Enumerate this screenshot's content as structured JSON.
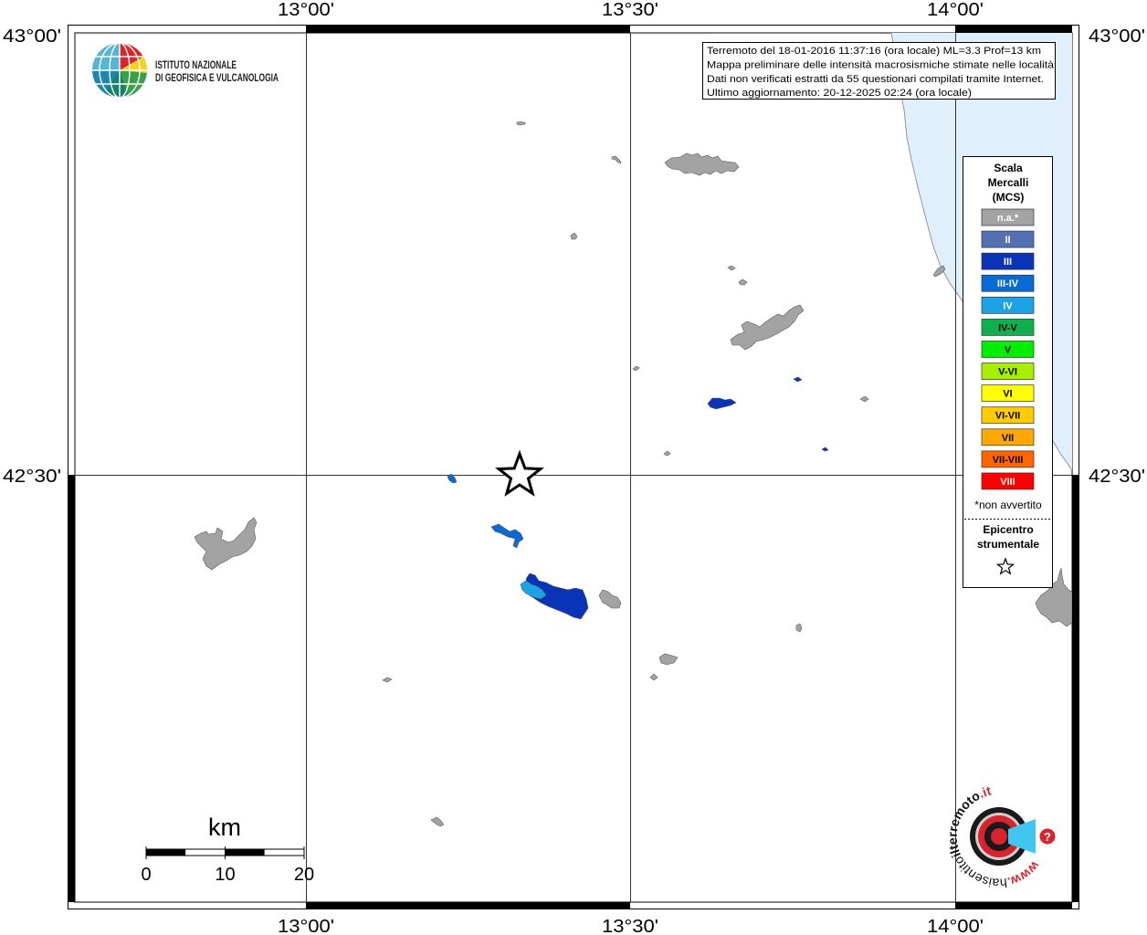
{
  "header": {
    "lon_labels": [
      "13°00'",
      "13°30'",
      "14°00'"
    ],
    "lat_labels": [
      "43°00'",
      "42°30'"
    ]
  },
  "logo_ingv": {
    "line1": "ISTITUTO NAZIONALE",
    "line2": "DI GEOFISICA E VULCANOLOGIA",
    "icon": "globe-icon"
  },
  "info": {
    "lines": [
      "Terremoto del 18-01-2016 11:37:16 (ora locale) ML=3.3 Prof=13 km",
      "Mappa preliminare delle intensità macrosismiche stimate nelle località",
      "Dati non verificati estratti da 55 questionari compilati tramite Internet.",
      "Ultimo aggiornamento: 20-12-2025 02:24 (ora locale)"
    ]
  },
  "legend": {
    "title_lines": [
      "Scala",
      "Mercalli",
      "(MCS)"
    ],
    "classes": [
      {
        "label": "n.a.*",
        "color": "#a3a3a3",
        "text_color": "#ffffff"
      },
      {
        "label": "II",
        "color": "#5470b4",
        "text_color": "#ffffff"
      },
      {
        "label": "III",
        "color": "#0a34b8",
        "text_color": "#ffffff"
      },
      {
        "label": "III-IV",
        "color": "#0a6ad4",
        "text_color": "#ffffff"
      },
      {
        "label": "IV",
        "color": "#1ca3e6",
        "text_color": "#ffffff"
      },
      {
        "label": "IV-V",
        "color": "#10b050",
        "text_color": "#000000"
      },
      {
        "label": "V",
        "color": "#00ee00",
        "text_color": "#000000"
      },
      {
        "label": "V-VI",
        "color": "#a8ee00",
        "text_color": "#000000"
      },
      {
        "label": "VI",
        "color": "#ffff00",
        "text_color": "#000000"
      },
      {
        "label": "VI-VII",
        "color": "#ffcc00",
        "text_color": "#000000"
      },
      {
        "label": "VII",
        "color": "#ffa800",
        "text_color": "#000000"
      },
      {
        "label": "VII-VIII",
        "color": "#ff6600",
        "text_color": "#000000"
      },
      {
        "label": "VIII",
        "color": "#ff0000",
        "text_color": "#ffffff"
      }
    ],
    "note": "*non avvertito",
    "epicenter_lines": [
      "Epicentro",
      "strumentale"
    ],
    "epicenter_icon": "star-icon"
  },
  "scale": {
    "unit": "km",
    "ticks": [
      "0",
      "10",
      "20"
    ]
  },
  "map": {
    "sea_color": "#dff0fc",
    "areas": [
      "n.a.*",
      "n.a.*",
      "n.a.*",
      "n.a.*",
      "n.a.*",
      "n.a.*",
      "n.a.*",
      "n.a.*",
      "n.a.*",
      "n.a.*",
      "n.a.*",
      "n.a.*",
      "n.a.*",
      "n.a.*",
      "n.a.*",
      "n.a.*",
      "n.a.*",
      "n.a.*",
      "n.a.*",
      "III",
      "III",
      "III",
      "III-IV",
      "III-IV",
      "III",
      "IV"
    ]
  },
  "logo_hst": {
    "parts": [
      "www.",
      "haisentito",
      "ilterremoto",
      ".it"
    ],
    "icon": "?"
  }
}
